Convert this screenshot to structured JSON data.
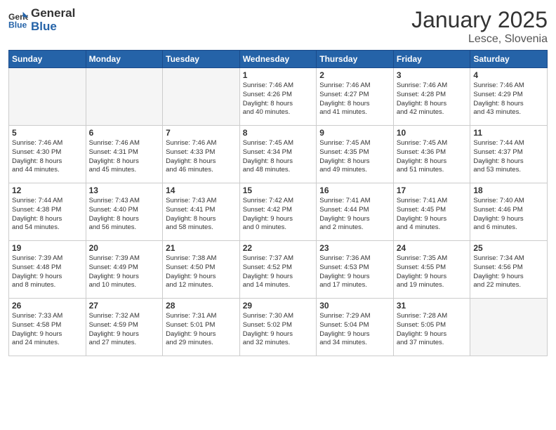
{
  "header": {
    "logo_general": "General",
    "logo_blue": "Blue",
    "month_title": "January 2025",
    "location": "Lesce, Slovenia"
  },
  "weekdays": [
    "Sunday",
    "Monday",
    "Tuesday",
    "Wednesday",
    "Thursday",
    "Friday",
    "Saturday"
  ],
  "weeks": [
    [
      {
        "day": "",
        "text": ""
      },
      {
        "day": "",
        "text": ""
      },
      {
        "day": "",
        "text": ""
      },
      {
        "day": "1",
        "text": "Sunrise: 7:46 AM\nSunset: 4:26 PM\nDaylight: 8 hours\nand 40 minutes."
      },
      {
        "day": "2",
        "text": "Sunrise: 7:46 AM\nSunset: 4:27 PM\nDaylight: 8 hours\nand 41 minutes."
      },
      {
        "day": "3",
        "text": "Sunrise: 7:46 AM\nSunset: 4:28 PM\nDaylight: 8 hours\nand 42 minutes."
      },
      {
        "day": "4",
        "text": "Sunrise: 7:46 AM\nSunset: 4:29 PM\nDaylight: 8 hours\nand 43 minutes."
      }
    ],
    [
      {
        "day": "5",
        "text": "Sunrise: 7:46 AM\nSunset: 4:30 PM\nDaylight: 8 hours\nand 44 minutes."
      },
      {
        "day": "6",
        "text": "Sunrise: 7:46 AM\nSunset: 4:31 PM\nDaylight: 8 hours\nand 45 minutes."
      },
      {
        "day": "7",
        "text": "Sunrise: 7:46 AM\nSunset: 4:33 PM\nDaylight: 8 hours\nand 46 minutes."
      },
      {
        "day": "8",
        "text": "Sunrise: 7:45 AM\nSunset: 4:34 PM\nDaylight: 8 hours\nand 48 minutes."
      },
      {
        "day": "9",
        "text": "Sunrise: 7:45 AM\nSunset: 4:35 PM\nDaylight: 8 hours\nand 49 minutes."
      },
      {
        "day": "10",
        "text": "Sunrise: 7:45 AM\nSunset: 4:36 PM\nDaylight: 8 hours\nand 51 minutes."
      },
      {
        "day": "11",
        "text": "Sunrise: 7:44 AM\nSunset: 4:37 PM\nDaylight: 8 hours\nand 53 minutes."
      }
    ],
    [
      {
        "day": "12",
        "text": "Sunrise: 7:44 AM\nSunset: 4:38 PM\nDaylight: 8 hours\nand 54 minutes."
      },
      {
        "day": "13",
        "text": "Sunrise: 7:43 AM\nSunset: 4:40 PM\nDaylight: 8 hours\nand 56 minutes."
      },
      {
        "day": "14",
        "text": "Sunrise: 7:43 AM\nSunset: 4:41 PM\nDaylight: 8 hours\nand 58 minutes."
      },
      {
        "day": "15",
        "text": "Sunrise: 7:42 AM\nSunset: 4:42 PM\nDaylight: 9 hours\nand 0 minutes."
      },
      {
        "day": "16",
        "text": "Sunrise: 7:41 AM\nSunset: 4:44 PM\nDaylight: 9 hours\nand 2 minutes."
      },
      {
        "day": "17",
        "text": "Sunrise: 7:41 AM\nSunset: 4:45 PM\nDaylight: 9 hours\nand 4 minutes."
      },
      {
        "day": "18",
        "text": "Sunrise: 7:40 AM\nSunset: 4:46 PM\nDaylight: 9 hours\nand 6 minutes."
      }
    ],
    [
      {
        "day": "19",
        "text": "Sunrise: 7:39 AM\nSunset: 4:48 PM\nDaylight: 9 hours\nand 8 minutes."
      },
      {
        "day": "20",
        "text": "Sunrise: 7:39 AM\nSunset: 4:49 PM\nDaylight: 9 hours\nand 10 minutes."
      },
      {
        "day": "21",
        "text": "Sunrise: 7:38 AM\nSunset: 4:50 PM\nDaylight: 9 hours\nand 12 minutes."
      },
      {
        "day": "22",
        "text": "Sunrise: 7:37 AM\nSunset: 4:52 PM\nDaylight: 9 hours\nand 14 minutes."
      },
      {
        "day": "23",
        "text": "Sunrise: 7:36 AM\nSunset: 4:53 PM\nDaylight: 9 hours\nand 17 minutes."
      },
      {
        "day": "24",
        "text": "Sunrise: 7:35 AM\nSunset: 4:55 PM\nDaylight: 9 hours\nand 19 minutes."
      },
      {
        "day": "25",
        "text": "Sunrise: 7:34 AM\nSunset: 4:56 PM\nDaylight: 9 hours\nand 22 minutes."
      }
    ],
    [
      {
        "day": "26",
        "text": "Sunrise: 7:33 AM\nSunset: 4:58 PM\nDaylight: 9 hours\nand 24 minutes."
      },
      {
        "day": "27",
        "text": "Sunrise: 7:32 AM\nSunset: 4:59 PM\nDaylight: 9 hours\nand 27 minutes."
      },
      {
        "day": "28",
        "text": "Sunrise: 7:31 AM\nSunset: 5:01 PM\nDaylight: 9 hours\nand 29 minutes."
      },
      {
        "day": "29",
        "text": "Sunrise: 7:30 AM\nSunset: 5:02 PM\nDaylight: 9 hours\nand 32 minutes."
      },
      {
        "day": "30",
        "text": "Sunrise: 7:29 AM\nSunset: 5:04 PM\nDaylight: 9 hours\nand 34 minutes."
      },
      {
        "day": "31",
        "text": "Sunrise: 7:28 AM\nSunset: 5:05 PM\nDaylight: 9 hours\nand 37 minutes."
      },
      {
        "day": "",
        "text": ""
      }
    ]
  ]
}
